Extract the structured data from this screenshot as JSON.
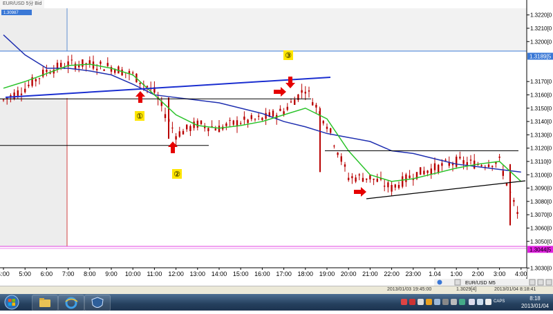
{
  "window": {
    "title": "EUR/USD 5分 Bid",
    "corner_price": "1.30987"
  },
  "price_axis": {
    "labels": [
      "1.3220[0",
      "1.3210[0",
      "1.3200[0",
      "1.3170[0",
      "1.3160[0",
      "1.3150[0",
      "1.3140[0",
      "1.3130[0",
      "1.3120[0",
      "1.3110[0",
      "1.3100[0",
      "1.3090[0",
      "1.3080[0",
      "1.3070[0",
      "1.3060[0",
      "1.3050[0",
      "1.3030[0"
    ],
    "highlight_top": "1.3189[5",
    "highlight_bottom": "1.3044[5"
  },
  "time_axis": {
    "labels": [
      "4:00",
      "5:00",
      "6:00",
      "7:00",
      "8:00",
      "9:00",
      "10:00",
      "11:00",
      "12:00",
      "13:00",
      "14:00",
      "15:00",
      "16:00",
      "17:00",
      "18:00",
      "19:00",
      "20:00",
      "21:00",
      "22:00",
      "23:00",
      "1.04",
      "1:00",
      "2:00",
      "3:00",
      "4:00"
    ]
  },
  "annotations": {
    "n1": "①",
    "n2": "②",
    "n3": "③"
  },
  "scrollbar": {
    "symbol": "EUR/USD",
    "timeframe": "M5"
  },
  "status_bar": {
    "left": "2013/01/03 19:45:00",
    "price": "1.3029[4]",
    "right": "2013/01/04 8:18:41"
  },
  "taskbar": {
    "time": "8:18",
    "date": "2013/01/04",
    "lang": "CAPS"
  },
  "colors": {
    "sma_blue": "#1f2fb0",
    "sma_green": "#2ac32a",
    "candle": "#b80000",
    "trend_line": "#1a2ed0",
    "arrow": "#e60000",
    "label_bg": "#ffe600",
    "purple_line": "#e040e0",
    "price_highlight": "#3a78d6",
    "magenta_badge": "#e020e0"
  },
  "chart_data": {
    "type": "candlestick",
    "title": "EUR/USD 5分 Bid",
    "instrument": "EUR/USD",
    "timeframe": "M5",
    "xlabel": "",
    "ylabel": "",
    "ylim": [
      1.3025,
      1.3225
    ],
    "x_range": [
      "4:00",
      "4:30 (next day)"
    ],
    "hourly_close": [
      {
        "t": "4:00",
        "v": 1.3156
      },
      {
        "t": "5:00",
        "v": 1.3165
      },
      {
        "t": "6:00",
        "v": 1.3178
      },
      {
        "t": "7:00",
        "v": 1.3183
      },
      {
        "t": "8:00",
        "v": 1.3183
      },
      {
        "t": "9:00",
        "v": 1.3181
      },
      {
        "t": "10:00",
        "v": 1.3175
      },
      {
        "t": "11:00",
        "v": 1.3162
      },
      {
        "t": "12:00",
        "v": 1.313
      },
      {
        "t": "13:00",
        "v": 1.3138
      },
      {
        "t": "14:00",
        "v": 1.3135
      },
      {
        "t": "15:00",
        "v": 1.314
      },
      {
        "t": "16:00",
        "v": 1.3142
      },
      {
        "t": "17:00",
        "v": 1.3148
      },
      {
        "t": "18:00",
        "v": 1.3165
      },
      {
        "t": "19:00",
        "v": 1.3138
      },
      {
        "t": "20:00",
        "v": 1.3098
      },
      {
        "t": "21:00",
        "v": 1.3098
      },
      {
        "t": "22:00",
        "v": 1.309
      },
      {
        "t": "23:00",
        "v": 1.31
      },
      {
        "t": "1.04",
        "v": 1.3105
      },
      {
        "t": "1:00",
        "v": 1.311
      },
      {
        "t": "2:00",
        "v": 1.3108
      },
      {
        "t": "3:00",
        "v": 1.311
      },
      {
        "t": "4:00",
        "v": 1.3062
      }
    ],
    "sma_long": [
      1.3205,
      1.319,
      1.318,
      1.318,
      1.3178,
      1.3175,
      1.3168,
      1.316,
      1.3158,
      1.3156,
      1.3154,
      1.315,
      1.3146,
      1.314,
      1.3136,
      1.3131,
      1.3128,
      1.3125,
      1.3118,
      1.3116,
      1.3112,
      1.3108,
      1.3106,
      1.3104,
      1.3102
    ],
    "sma_short": [
      1.3165,
      1.317,
      1.3176,
      1.3182,
      1.3183,
      1.318,
      1.3175,
      1.316,
      1.3145,
      1.3137,
      1.3135,
      1.3137,
      1.314,
      1.3145,
      1.315,
      1.3142,
      1.3118,
      1.31,
      1.3095,
      1.3097,
      1.3101,
      1.3105,
      1.3108,
      1.311,
      1.3095
    ],
    "horizontal_levels": [
      1.3157,
      1.3122,
      1.3118
    ],
    "trend_lines": [
      {
        "from": {
          "t": "4:00",
          "v": 1.3157
        },
        "to": {
          "t": "19:00",
          "v": 1.3172
        }
      },
      {
        "from": {
          "t": "22:00",
          "v": 1.3082
        },
        "to": {
          "t": "4:00",
          "v": 1.3095
        }
      }
    ],
    "current_price": 1.3044,
    "top_marker_price": 1.3189
  }
}
